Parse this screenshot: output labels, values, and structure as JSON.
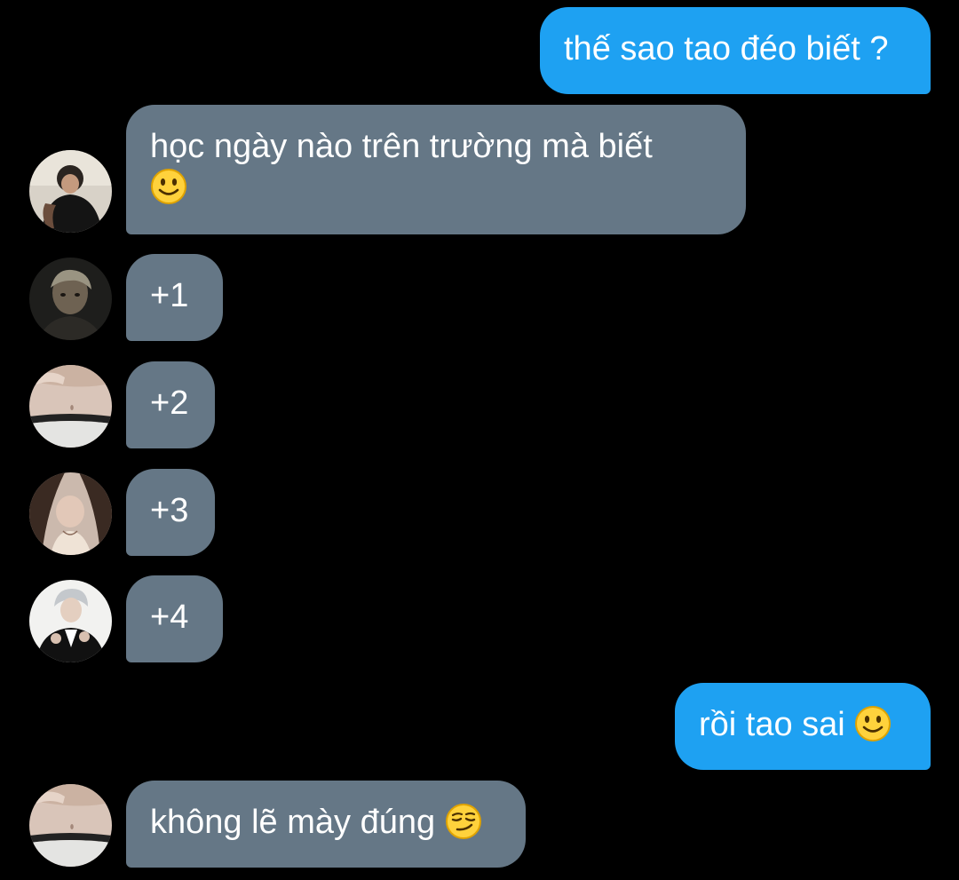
{
  "conversation": {
    "messages": [
      {
        "direction": "outgoing",
        "text": "thế sao tao đéo biết ?"
      },
      {
        "direction": "incoming",
        "text": "học ngày nào trên trường mà biết",
        "emoji": "slightly-smiling-face-emoji",
        "avatar": "avatar-person-black-shirt"
      },
      {
        "direction": "incoming",
        "text": "+1",
        "avatar": "avatar-person-dark-portrait"
      },
      {
        "direction": "incoming",
        "text": "+2",
        "avatar": "avatar-person-waist"
      },
      {
        "direction": "incoming",
        "text": "+3",
        "avatar": "avatar-person-long-hair"
      },
      {
        "direction": "incoming",
        "text": "+4",
        "avatar": "avatar-person-silver-hair"
      },
      {
        "direction": "outgoing",
        "text": "rồi tao sai",
        "emoji": "slightly-smiling-face-emoji"
      },
      {
        "direction": "incoming",
        "text": "không lẽ mày đúng",
        "emoji": "smirking-face-emoji",
        "avatar": "avatar-person-waist"
      }
    ]
  },
  "colors": {
    "background": "#000000",
    "outgoing_bubble": "#1ea1f2",
    "incoming_bubble": "#657786",
    "text": "#ffffff"
  }
}
